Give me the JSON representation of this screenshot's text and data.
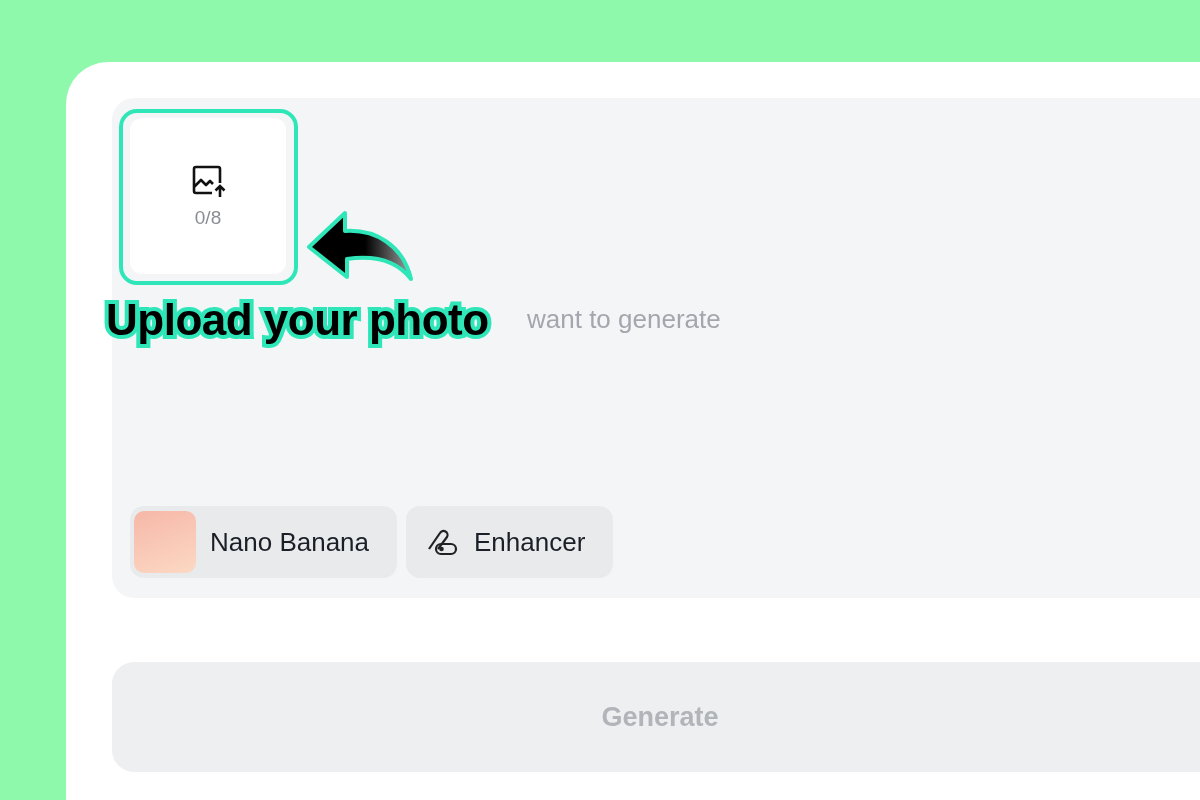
{
  "upload": {
    "count": "0/8"
  },
  "annotation": {
    "text": "Upload your photo"
  },
  "prompt": {
    "placeholder": "want to generate"
  },
  "chips": [
    {
      "kind": "model",
      "label": "Nano Banana"
    },
    {
      "kind": "tool",
      "label": "Enhancer"
    }
  ],
  "generate_button": {
    "label": "Generate",
    "disabled": true
  }
}
